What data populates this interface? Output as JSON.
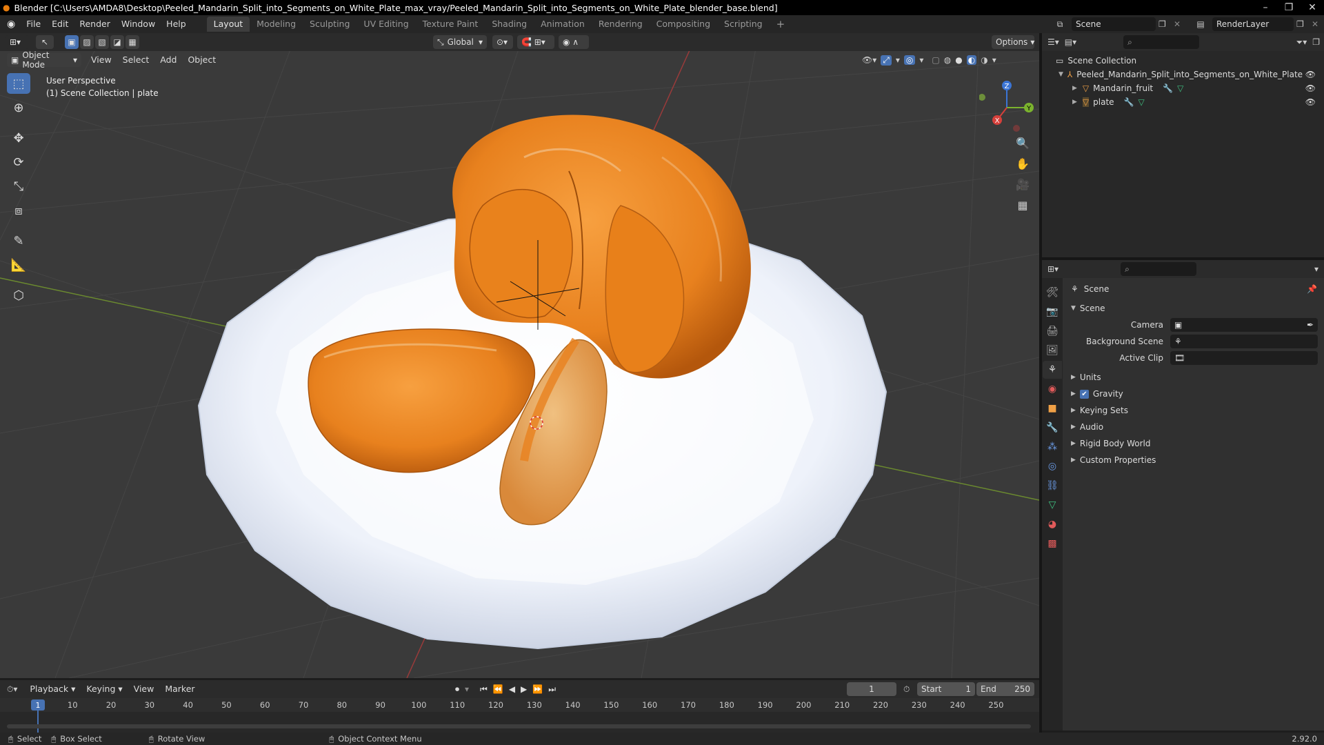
{
  "title_bar": {
    "text": "Blender [C:\\Users\\AMDA8\\Desktop\\Peeled_Mandarin_Split_into_Segments_on_White_Plate_max_vray/Peeled_Mandarin_Split_into_Segments_on_White_Plate_blender_base.blend]"
  },
  "menu": {
    "items": [
      "File",
      "Edit",
      "Render",
      "Window",
      "Help"
    ]
  },
  "workspaces": [
    "Layout",
    "Modeling",
    "Sculpting",
    "UV Editing",
    "Texture Paint",
    "Shading",
    "Animation",
    "Rendering",
    "Compositing",
    "Scripting"
  ],
  "top_right": {
    "scene": "Scene",
    "view_layer": "RenderLayer"
  },
  "viewport": {
    "transform_orientation": "Global",
    "options_label": "Options",
    "mode": "Object Mode",
    "menus": [
      "View",
      "Select",
      "Add",
      "Object"
    ],
    "overlay_line1": "User Perspective",
    "overlay_line2": "(1) Scene Collection | plate",
    "gizmo": {
      "x": "X",
      "y": "Y",
      "z": "Z"
    }
  },
  "outliner": {
    "root": "Scene Collection",
    "collection": "Peeled_Mandarin_Split_into_Segments_on_White_Plate",
    "objects": [
      "Mandarin_fruit",
      "plate"
    ]
  },
  "properties": {
    "header": "Scene",
    "section": "Scene",
    "fields": {
      "camera": "Camera",
      "background_scene": "Background Scene",
      "active_clip": "Active Clip"
    },
    "panels": [
      "Units",
      "Gravity",
      "Keying Sets",
      "Audio",
      "Rigid Body World",
      "Custom Properties"
    ],
    "gravity_checked": true
  },
  "timeline": {
    "menus": [
      "Playback",
      "Keying",
      "View",
      "Marker"
    ],
    "current_frame": "1",
    "start_label": "Start",
    "start": "1",
    "end_label": "End",
    "end": "250",
    "ticks": [
      "10",
      "20",
      "30",
      "40",
      "50",
      "60",
      "70",
      "80",
      "90",
      "100",
      "110",
      "120",
      "130",
      "140",
      "150",
      "160",
      "170",
      "180",
      "190",
      "200",
      "210",
      "220",
      "230",
      "240",
      "250"
    ],
    "playhead": "1"
  },
  "status": {
    "select": "Select",
    "box_select": "Box Select",
    "rotate_view": "Rotate View",
    "context_menu": "Object Context Menu",
    "version": "2.92.0"
  },
  "colors": {
    "accent": "#4772b3",
    "viewport_bg": "#3a3a3a",
    "panel_bg": "#303030",
    "orange": "#e8811e"
  }
}
